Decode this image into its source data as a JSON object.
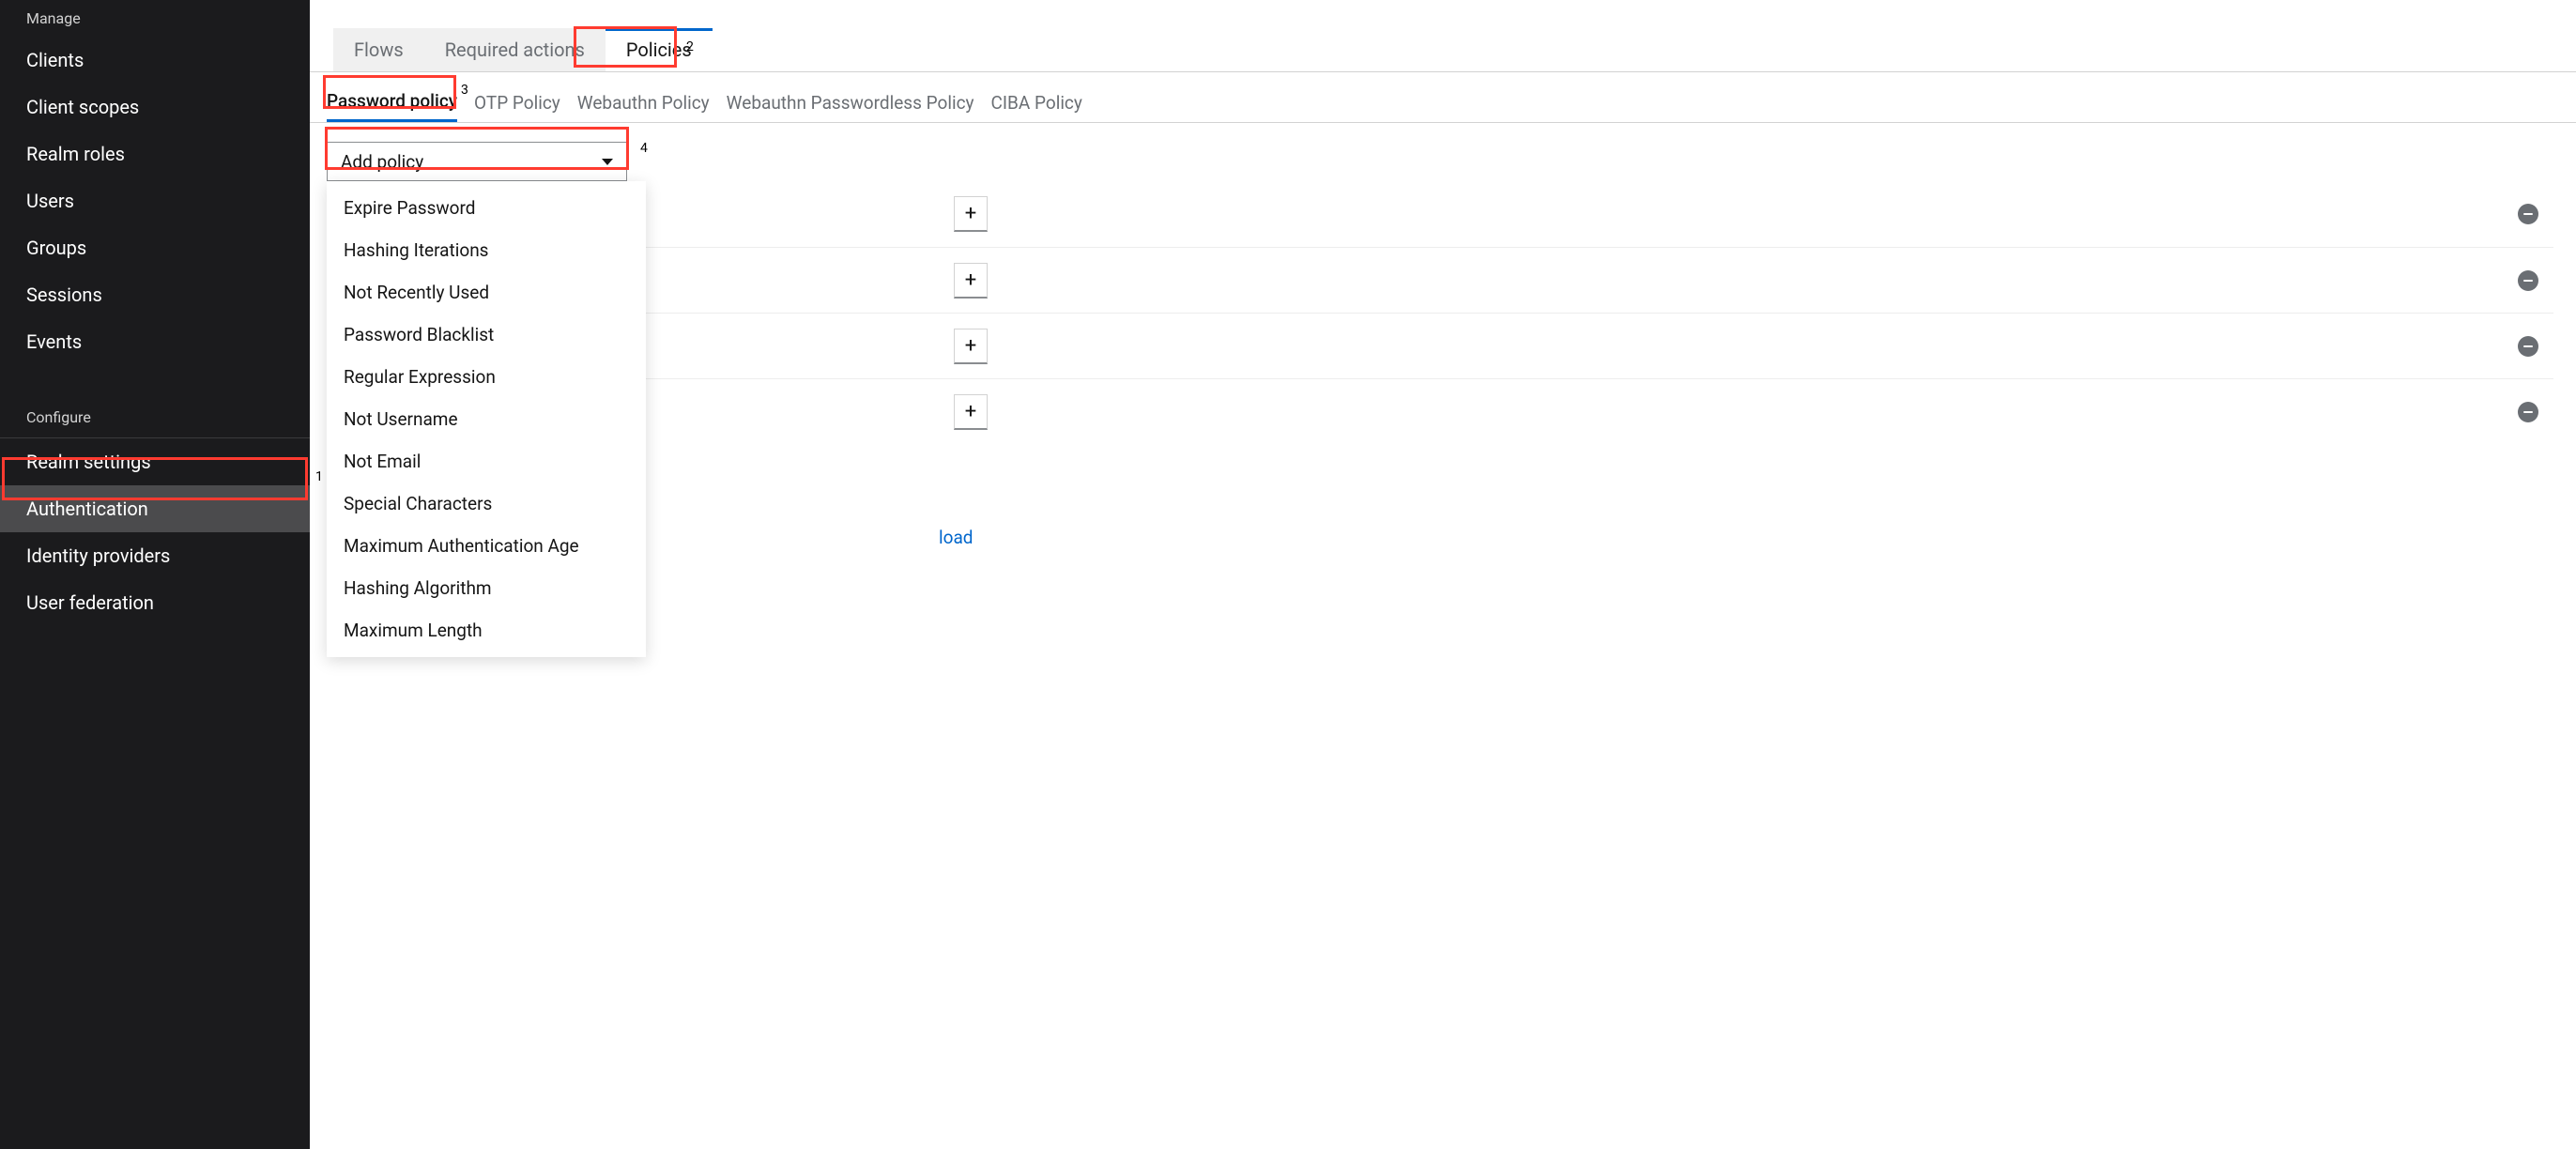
{
  "sidebar": {
    "section_manage": "Manage",
    "items_manage": {
      "clients": "Clients",
      "client_scopes": "Client scopes",
      "realm_roles": "Realm roles",
      "users": "Users",
      "groups": "Groups",
      "sessions": "Sessions",
      "events": "Events"
    },
    "section_configure": "Configure",
    "items_configure": {
      "realm_settings": "Realm settings",
      "authentication": "Authentication",
      "identity_providers": "Identity providers",
      "user_federation": "User federation"
    }
  },
  "tabs": {
    "flows": "Flows",
    "required_actions": "Required actions",
    "policies": "Policies"
  },
  "subtabs": {
    "password_policy": "Password policy",
    "otp_policy": "OTP Policy",
    "webauthn_policy": "Webauthn Policy",
    "webauthn_passwordless_policy": "Webauthn Passwordless Policy",
    "ciba_policy": "CIBA Policy"
  },
  "add_policy": {
    "label": "Add policy",
    "options": {
      "expire_password": "Expire Password",
      "hashing_iterations": "Hashing Iterations",
      "not_recently_used": "Not Recently Used",
      "password_blacklist": "Password Blacklist",
      "regular_expression": "Regular Expression",
      "not_username": "Not Username",
      "not_email": "Not Email",
      "special_characters": "Special Characters",
      "max_auth_age": "Maximum Authentication Age",
      "hashing_algorithm": "Hashing Algorithm",
      "maximum_length": "Maximum Length"
    }
  },
  "reload_label": "load",
  "annotations": {
    "n1": "1",
    "n2": "2",
    "n3": "3",
    "n4": "4"
  }
}
